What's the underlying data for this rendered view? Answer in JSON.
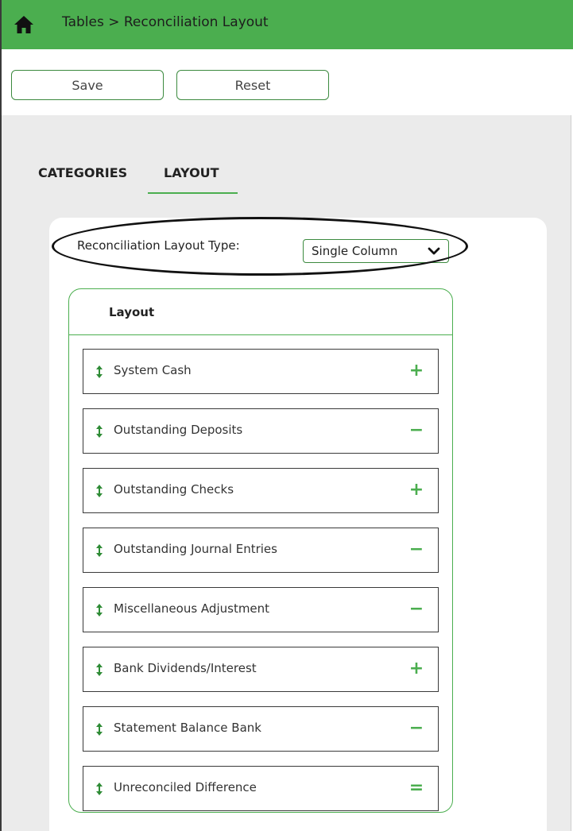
{
  "header": {
    "breadcrumb": "Tables > Reconciliation Layout",
    "home_icon": "home-icon",
    "bar_color": "#4bae4f"
  },
  "toolbar": {
    "save_label": "Save",
    "reset_label": "Reset"
  },
  "tabs": [
    {
      "label": "CATEGORIES",
      "active": false
    },
    {
      "label": "LAYOUT",
      "active": true
    }
  ],
  "layout_type": {
    "label": "Reconciliation Layout Type:",
    "selected": "Single Column"
  },
  "layout": {
    "title": "Layout",
    "items": [
      {
        "label": "System Cash",
        "op": "+",
        "op_icon": "plus-icon"
      },
      {
        "label": "Outstanding Deposits",
        "op": "−",
        "op_icon": "minus-icon"
      },
      {
        "label": "Outstanding Checks",
        "op": "+",
        "op_icon": "plus-icon"
      },
      {
        "label": "Outstanding Journal Entries",
        "op": "−",
        "op_icon": "minus-icon"
      },
      {
        "label": "Miscellaneous Adjustment",
        "op": "−",
        "op_icon": "minus-icon"
      },
      {
        "label": "Bank Dividends/Interest",
        "op": "+",
        "op_icon": "plus-icon"
      },
      {
        "label": "Statement Balance Bank",
        "op": "−",
        "op_icon": "minus-icon"
      },
      {
        "label": "Unreconciled Difference",
        "op": "=",
        "op_icon": "equals-icon"
      }
    ]
  },
  "colors": {
    "accent": "#4bae4f",
    "border_green": "#3c8a3f"
  }
}
